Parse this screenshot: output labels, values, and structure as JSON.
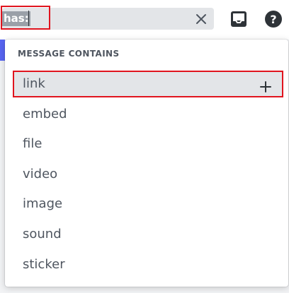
{
  "search": {
    "token": "has:",
    "value": ""
  },
  "toolbar": {
    "clear_icon": "close-icon",
    "inbox_icon": "inbox-icon",
    "help_icon": "help-icon"
  },
  "popout": {
    "header": "MESSAGE CONTAINS",
    "options": [
      {
        "label": "link",
        "selected": true,
        "action_icon": "plus-icon"
      },
      {
        "label": "embed"
      },
      {
        "label": "file"
      },
      {
        "label": "video"
      },
      {
        "label": "image"
      },
      {
        "label": "sound"
      },
      {
        "label": "sticker"
      }
    ]
  },
  "colors": {
    "highlight_border": "#e0141e",
    "accent": "#5865f2",
    "text": "#4f5660"
  }
}
